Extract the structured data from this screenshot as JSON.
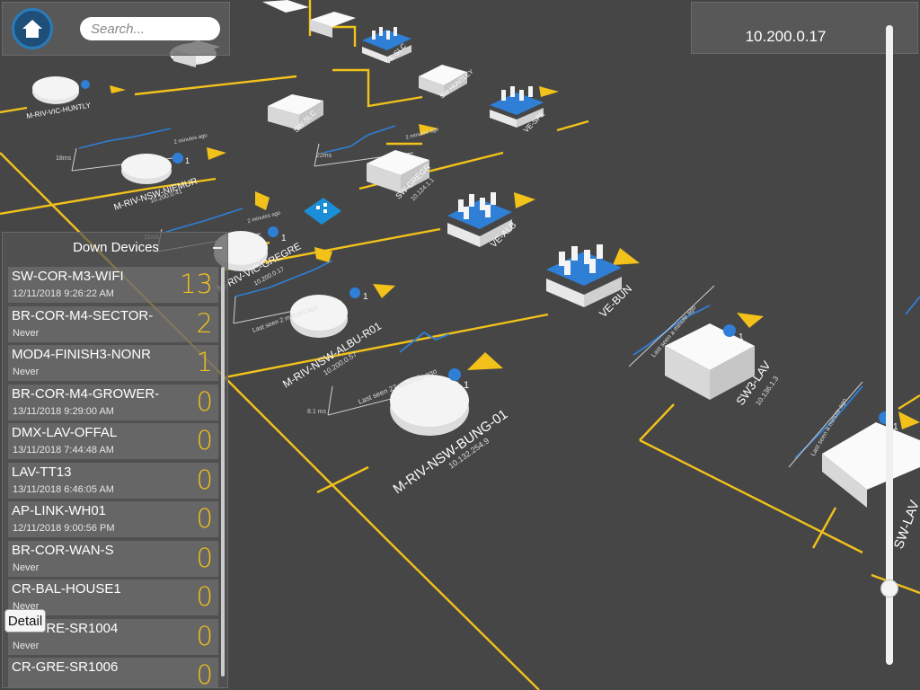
{
  "search": {
    "placeholder": "Search..."
  },
  "selected_ip": "10.200.0.17",
  "zoom_level_percent": 12,
  "map": {
    "devices": [
      {
        "name": "M-RIV-VIC-HUNTLY",
        "ip": "",
        "badge": "1"
      },
      {
        "name": "SW-SLC",
        "ip": "",
        "badge": ""
      },
      {
        "name": "VE-SLC",
        "ip": "",
        "badge": ""
      },
      {
        "name": "SW-HUNTLEY",
        "ip": "",
        "badge": ""
      },
      {
        "name": "VE-SPE",
        "ip": "",
        "badge": ""
      },
      {
        "name": "M-RIV-NSW-NIEMUR",
        "ip": "10.200.0.41",
        "badge": "1",
        "last_seen": "2 minutes ago"
      },
      {
        "name": "SW-GREGR",
        "ip": "10.124.1.1",
        "badge": "",
        "last_seen": "2 minutes ago"
      },
      {
        "name": "VE-ALB",
        "ip": "",
        "badge": ""
      },
      {
        "name": "M-RIV-VIC-GREGRE",
        "ip": "10.200.0.17",
        "badge": "1",
        "last_seen": "2 minutes ago"
      },
      {
        "name": "M-RIV-NSW-ALBU-R01",
        "ip": "10.200.0.57",
        "badge": "1",
        "last_seen": "Last seen 2 minutes ago"
      },
      {
        "name": "VE-BUN",
        "ip": "",
        "badge": ""
      },
      {
        "name": "M-RIV-NSW-BUNG-01",
        "ip": "10.132.254.9",
        "badge": "1",
        "last_seen": "Last seen 27 seconds ago"
      },
      {
        "name": "SW3-LAV",
        "ip": "10.136.1.3",
        "badge": "1",
        "last_seen": "Last seen a minute ago"
      },
      {
        "name": "SW-LAV",
        "ip": "",
        "badge": "1",
        "last_seen": "Last seen a minute ago"
      }
    ],
    "axis_labels": {
      "a": "18ms",
      "b": "22ms",
      "c": "11ms",
      "d": "8.1 ms"
    }
  },
  "down_devices": {
    "title": "Down Devices",
    "items": [
      {
        "name": "SW-COR-M3-WIFI",
        "time": "12/11/2018 9:26:22 AM",
        "count": "13"
      },
      {
        "name": "BR-COR-M4-SECTOR-",
        "time": "Never",
        "count": "2"
      },
      {
        "name": "MOD4-FINISH3-NONR",
        "time": "Never",
        "count": "1"
      },
      {
        "name": "BR-COR-M4-GROWER-",
        "time": "13/11/2018 9:29:00 AM",
        "count": "0"
      },
      {
        "name": "DMX-LAV-OFFAL",
        "time": "13/11/2018 7:44:48 AM",
        "count": "0"
      },
      {
        "name": "LAV-TT13",
        "time": "13/11/2018 6:46:05 AM",
        "count": "0"
      },
      {
        "name": "AP-LINK-WH01",
        "time": "12/11/2018 9:00:56 PM",
        "count": "0"
      },
      {
        "name": "BR-COR-WAN-S",
        "time": "Never",
        "count": "0"
      },
      {
        "name": "CR-BAL-HOUSE1",
        "time": "Never",
        "count": "0"
      },
      {
        "name": "CR-GRE-SR1004",
        "time": "Never",
        "count": "0"
      },
      {
        "name": "CR-GRE-SR1006",
        "time": "",
        "count": "0"
      }
    ],
    "detail_label": "Detail"
  },
  "colors": {
    "background": "#464646",
    "link_line": "#f2c21a",
    "sparkline": "#2f7fd6",
    "badge": "#2f7fd6",
    "device_fill": "#ececec"
  }
}
